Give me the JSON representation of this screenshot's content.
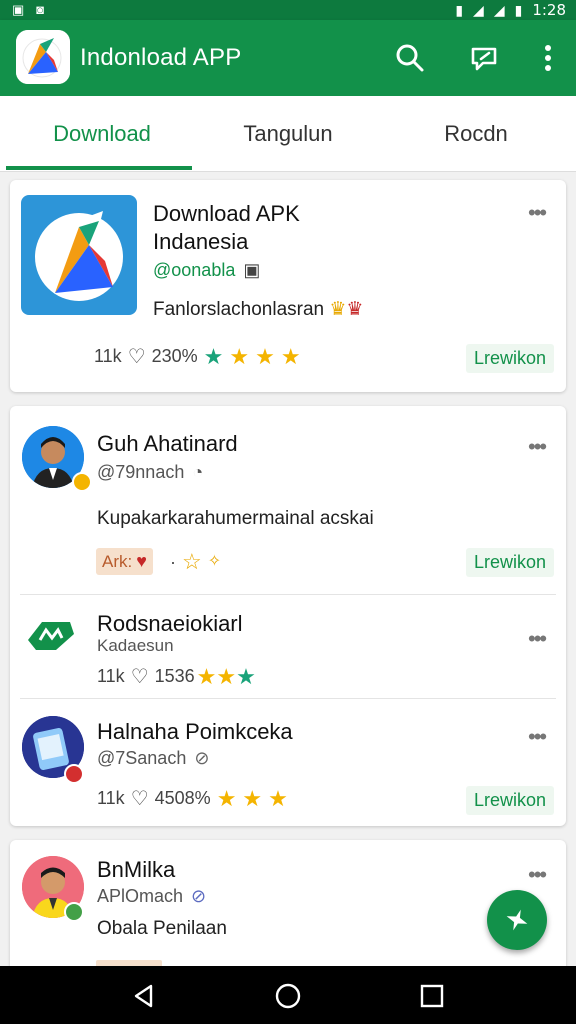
{
  "status_bar": {
    "time": "1:28"
  },
  "app_bar": {
    "title": "Indonload APP"
  },
  "tabs": [
    {
      "label": "Download",
      "active": true
    },
    {
      "label": "Tangulun",
      "active": false
    },
    {
      "label": "Rocdn",
      "active": false
    }
  ],
  "feature_card": {
    "title_line1": "Download APK",
    "title_line2": "Indanesia",
    "handle": "@oonabla",
    "description": "Fanlorslachonlasran",
    "count": "11k",
    "percent": "230%",
    "action_label": "Lrewikon"
  },
  "posts": [
    {
      "name": "Guh Ahatinard",
      "handle": "@79nnach",
      "body": "Kupakarkarahumermainal acskai",
      "tag": "Ark:",
      "action_label": "Lrewikon"
    },
    {
      "name": "Rodsnaeiokiarl",
      "handle": "Kadaesun",
      "count": "11k",
      "percent": "1536"
    },
    {
      "name": "Halnaha Poimkceka",
      "handle": "@7Sanach",
      "count": "11k",
      "percent": "4508%",
      "action_label": "Lrewikon"
    },
    {
      "name": "BnMilka",
      "handle": "APlOmach",
      "body": "Obala Penilaan"
    }
  ],
  "colors": {
    "primary": "#12914a",
    "status_bar": "#0d7a3e",
    "star": "#f4b400"
  }
}
